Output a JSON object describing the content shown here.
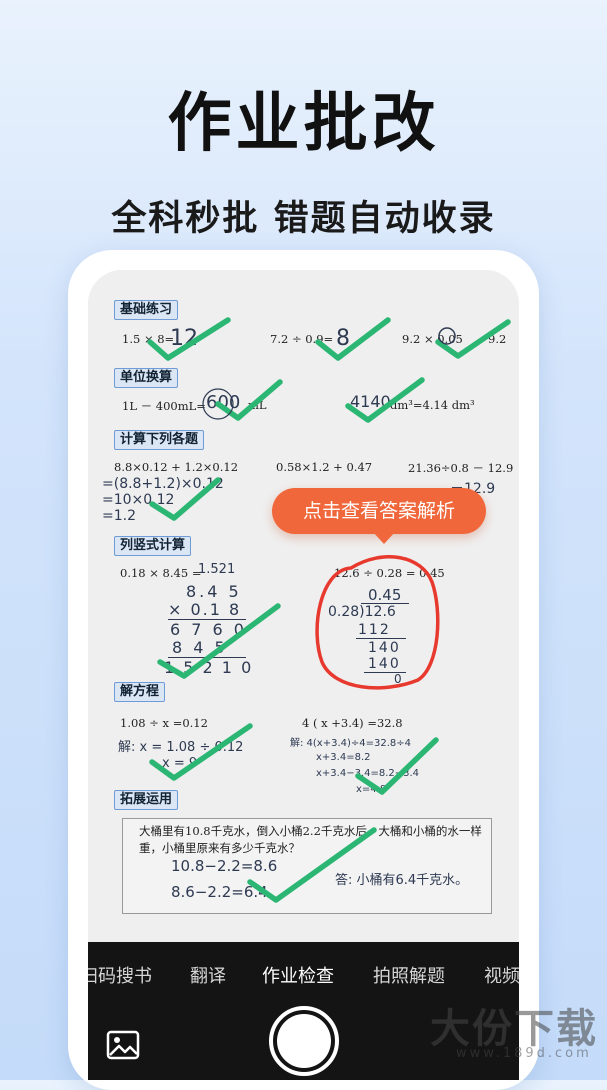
{
  "header": {
    "title": "作业批改",
    "subtitle": "全科秒批 错题自动收录"
  },
  "sections": [
    {
      "label": "基础练习"
    },
    {
      "label": "单位换算"
    },
    {
      "label": "计算下列各题"
    },
    {
      "label": "列竖式计算"
    },
    {
      "label": "解方程"
    },
    {
      "label": "拓展运用"
    }
  ],
  "questions": {
    "q1": "1.5 × 8=",
    "a1": "12",
    "q2": "7.2 ÷ 0.9=",
    "a2": "8",
    "q3": "9.2 × 0.05",
    "q3b": "9.2",
    "q4": "1L － 400mL=",
    "a4": "600",
    "q4b": "mL",
    "q5b": "dm³=4.14 dm³",
    "a5": "4140",
    "q6": "8.8×0.12 + 1.2×0.12",
    "q7": "0.58×1.2 + 0.47",
    "q8": "21.36÷0.8 － 12.9",
    "w6a": "=(8.8+1.2)×0.12",
    "w6b": "=10×0.12",
    "w6c": "=1.2",
    "w8": "－12.9",
    "q9": "0.18 × 8.45 =",
    "a9": "1.521",
    "v1": "8.4 5",
    "v2": "× 0.1 8",
    "v3": "6 7 6 0",
    "v4": "8 4 5",
    "v5": "1.5 2 1 0",
    "q10": "12.6 ÷ 0.28 = 0.45",
    "d1": "0.45",
    "d2": "0.28)12.6",
    "d3": "112",
    "d4": "140",
    "d5": "140",
    "d6": "0",
    "q11": "1.08 ÷ x =0.12",
    "w11a": "解: x = 1.08 ÷ 0.12",
    "w11b": "x = 9",
    "q12": "4 ( x +3.4) =32.8",
    "w12a": "解: 4(x+3.4)÷4=32.8÷4",
    "w12b": "x+3.4=8.2",
    "w12c": "x+3.4−3.4=8.2−3.4",
    "w12d": "x=4.8",
    "word": "大桶里有10.8千克水，倒入小桶2.2千克水后，大桶和小桶的水一样重，小桶里原来有多少千克水？",
    "w13a": "10.8−2.2=8.6",
    "w13b": "8.6−2.2=6.4",
    "w13c": "答: 小桶有6.4千克水。"
  },
  "tooltip": "点击查看答案解析",
  "modes": [
    "扫码搜书",
    "翻译",
    "作业检查",
    "拍照解题",
    "视频"
  ],
  "active_mode": "作业检查",
  "watermark": {
    "text": "大份下载",
    "url": "www.189d.com"
  },
  "colors": {
    "check": "#2bb673",
    "circle": "#e8392f",
    "tooltip": "#f0673b",
    "accent": "#6f9bd7"
  }
}
